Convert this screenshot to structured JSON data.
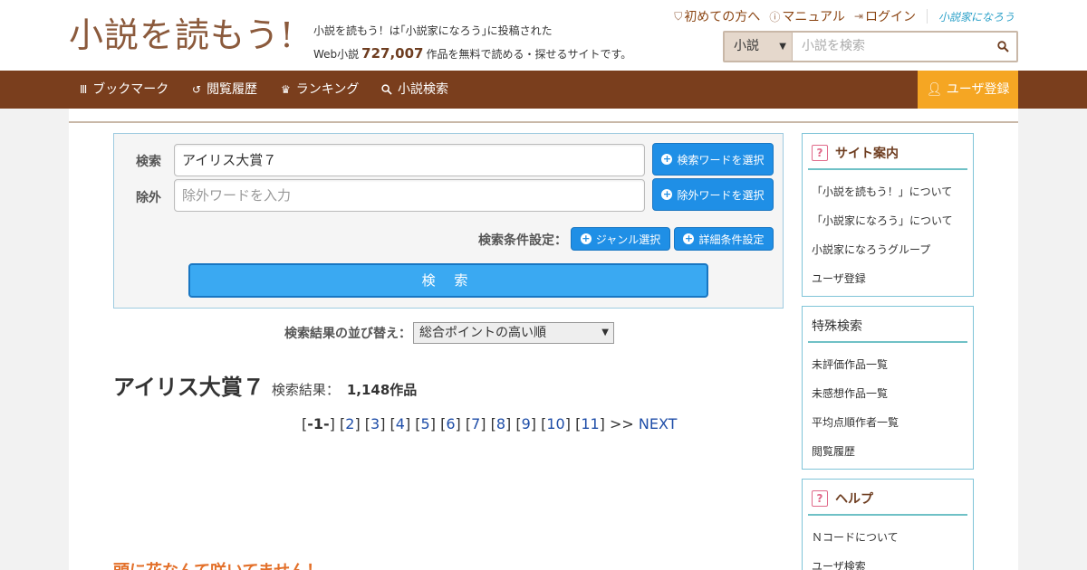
{
  "header": {
    "logo_text": "小説を読もう!",
    "tagline_line1": "小説を読もう！は｢小説家になろう｣に投稿された",
    "tagline_prefix": "Web小説",
    "tagline_count": "727,007",
    "tagline_suffix": "作品を無料で読める・探せるサイトです。",
    "links": {
      "beginners": "初めての方へ",
      "manual": "マニュアル",
      "login": "ログイン",
      "narou": "小説家になろう"
    },
    "search": {
      "category": "小説",
      "placeholder": "小説を検索"
    }
  },
  "nav": {
    "bookmark": "ブックマーク",
    "history": "閲覧履歴",
    "ranking": "ランキング",
    "search": "小説検索",
    "register": "ユーザ登録"
  },
  "search_panel": {
    "search_label": "検索",
    "search_value": "アイリス大賞７",
    "exclude_label": "除外",
    "exclude_placeholder": "除外ワードを入力",
    "select_search_word": "検索ワードを選択",
    "select_exclude_word": "除外ワードを選択",
    "condition_label": "検索条件設定：",
    "genre_button": "ジャンル選択",
    "detail_button": "詳細条件設定",
    "submit": "検 索"
  },
  "sort": {
    "label": "検索結果の並び替え：",
    "selected": "総合ポイントの高い順"
  },
  "results": {
    "query": "アイリス大賞７",
    "label": "検索結果：",
    "count": "1,148作品",
    "pager": {
      "current": "-1-",
      "pages": [
        "2",
        "3",
        "4",
        "5",
        "6",
        "7",
        "8",
        "9",
        "10",
        "11"
      ],
      "next_arrow": ">>",
      "next": "NEXT"
    },
    "first_title": "頭に花なんて咲いてません！"
  },
  "sidebar": {
    "site_guide": {
      "title": "サイト案内",
      "items": [
        "「小説を読もう！」について",
        "「小説家になろう」について",
        "小説家になろうグループ",
        "ユーザ登録"
      ]
    },
    "special_search": {
      "title": "特殊検索",
      "items": [
        "未評価作品一覧",
        "未感想作品一覧",
        "平均点順作者一覧",
        "閲覧履歴"
      ]
    },
    "help": {
      "title": "ヘルプ",
      "items": [
        "Ｎコードについて",
        "ユーザ検索"
      ]
    }
  },
  "colors": {
    "brand_brown": "#7a3e1d",
    "accent_orange": "#f5a623",
    "button_blue": "#1f8fe6",
    "sidebar_teal": "#6fc1c6"
  }
}
